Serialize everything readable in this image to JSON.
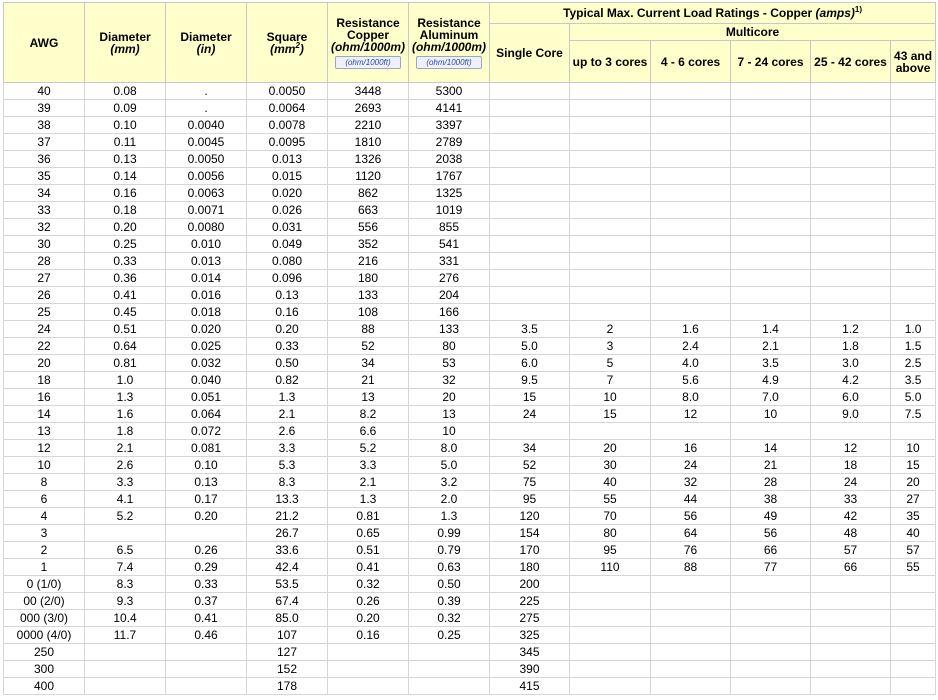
{
  "headers": {
    "awg": "AWG",
    "diam_mm": "Diameter",
    "diam_mm_unit": "(mm)",
    "diam_in": "Diameter",
    "diam_in_unit": "(in)",
    "square": "Square",
    "square_unit_pre": "(mm",
    "square_unit_sup": "2",
    "square_unit_post": ")",
    "res_cu": "Resistance Copper",
    "res_cu_unit": "(ohm/1000m)",
    "res_cu_btn": "(ohm/1000ft)",
    "res_al": "Resistance Aluminum",
    "res_al_unit": "(ohm/1000m)",
    "res_al_btn": "(ohm/1000ft)",
    "load_title": "Typical Max. Current Load Ratings - Copper ",
    "load_title_unit": "(amps)",
    "load_title_sup": "1)",
    "single_core": "Single Core",
    "multicore": "Multicore",
    "c1": "up to 3 cores",
    "c2": "4 - 6 cores",
    "c3": "7 - 24 cores",
    "c4": "25 - 42 cores",
    "c5": "43 and above"
  },
  "rows": [
    [
      "40",
      "0.08",
      ".",
      "0.0050",
      "3448",
      "5300",
      "",
      "",
      "",
      "",
      "",
      ""
    ],
    [
      "39",
      "0.09",
      ".",
      "0.0064",
      "2693",
      "4141",
      "",
      "",
      "",
      "",
      "",
      ""
    ],
    [
      "38",
      "0.10",
      "0.0040",
      "0.0078",
      "2210",
      "3397",
      "",
      "",
      "",
      "",
      "",
      ""
    ],
    [
      "37",
      "0.11",
      "0.0045",
      "0.0095",
      "1810",
      "2789",
      "",
      "",
      "",
      "",
      "",
      ""
    ],
    [
      "36",
      "0.13",
      "0.0050",
      "0.013",
      "1326",
      "2038",
      "",
      "",
      "",
      "",
      "",
      ""
    ],
    [
      "35",
      "0.14",
      "0.0056",
      "0.015",
      "1120",
      "1767",
      "",
      "",
      "",
      "",
      "",
      ""
    ],
    [
      "34",
      "0.16",
      "0.0063",
      "0.020",
      "862",
      "1325",
      "",
      "",
      "",
      "",
      "",
      ""
    ],
    [
      "33",
      "0.18",
      "0.0071",
      "0.026",
      "663",
      "1019",
      "",
      "",
      "",
      "",
      "",
      ""
    ],
    [
      "32",
      "0.20",
      "0.0080",
      "0.031",
      "556",
      "855",
      "",
      "",
      "",
      "",
      "",
      ""
    ],
    [
      "30",
      "0.25",
      "0.010",
      "0.049",
      "352",
      "541",
      "",
      "",
      "",
      "",
      "",
      ""
    ],
    [
      "28",
      "0.33",
      "0.013",
      "0.080",
      "216",
      "331",
      "",
      "",
      "",
      "",
      "",
      ""
    ],
    [
      "27",
      "0.36",
      "0.014",
      "0.096",
      "180",
      "276",
      "",
      "",
      "",
      "",
      "",
      ""
    ],
    [
      "26",
      "0.41",
      "0.016",
      "0.13",
      "133",
      "204",
      "",
      "",
      "",
      "",
      "",
      ""
    ],
    [
      "25",
      "0.45",
      "0.018",
      "0.16",
      "108",
      "166",
      "",
      "",
      "",
      "",
      "",
      ""
    ],
    [
      "24",
      "0.51",
      "0.020",
      "0.20",
      "88",
      "133",
      "3.5",
      "2",
      "1.6",
      "1.4",
      "1.2",
      "1.0"
    ],
    [
      "22",
      "0.64",
      "0.025",
      "0.33",
      "52",
      "80",
      "5.0",
      "3",
      "2.4",
      "2.1",
      "1.8",
      "1.5"
    ],
    [
      "20",
      "0.81",
      "0.032",
      "0.50",
      "34",
      "53",
      "6.0",
      "5",
      "4.0",
      "3.5",
      "3.0",
      "2.5"
    ],
    [
      "18",
      "1.0",
      "0.040",
      "0.82",
      "21",
      "32",
      "9.5",
      "7",
      "5.6",
      "4.9",
      "4.2",
      "3.5"
    ],
    [
      "16",
      "1.3",
      "0.051",
      "1.3",
      "13",
      "20",
      "15",
      "10",
      "8.0",
      "7.0",
      "6.0",
      "5.0"
    ],
    [
      "14",
      "1.6",
      "0.064",
      "2.1",
      "8.2",
      "13",
      "24",
      "15",
      "12",
      "10",
      "9.0",
      "7.5"
    ],
    [
      "13",
      "1.8",
      "0.072",
      "2.6",
      "6.6",
      "10",
      "",
      "",
      "",
      "",
      "",
      ""
    ],
    [
      "12",
      "2.1",
      "0.081",
      "3.3",
      "5.2",
      "8.0",
      "34",
      "20",
      "16",
      "14",
      "12",
      "10"
    ],
    [
      "10",
      "2.6",
      "0.10",
      "5.3",
      "3.3",
      "5.0",
      "52",
      "30",
      "24",
      "21",
      "18",
      "15"
    ],
    [
      "8",
      "3.3",
      "0.13",
      "8.3",
      "2.1",
      "3.2",
      "75",
      "40",
      "32",
      "28",
      "24",
      "20"
    ],
    [
      "6",
      "4.1",
      "0.17",
      "13.3",
      "1.3",
      "2.0",
      "95",
      "55",
      "44",
      "38",
      "33",
      "27"
    ],
    [
      "4",
      "5.2",
      "0.20",
      "21.2",
      "0.81",
      "1.3",
      "120",
      "70",
      "56",
      "49",
      "42",
      "35"
    ],
    [
      "3",
      "",
      "",
      "26.7",
      "0.65",
      "0.99",
      "154",
      "80",
      "64",
      "56",
      "48",
      "40"
    ],
    [
      "2",
      "6.5",
      "0.26",
      "33.6",
      "0.51",
      "0.79",
      "170",
      "95",
      "76",
      "66",
      "57",
      "57"
    ],
    [
      "1",
      "7.4",
      "0.29",
      "42.4",
      "0.41",
      "0.63",
      "180",
      "110",
      "88",
      "77",
      "66",
      "55"
    ],
    [
      "0 (1/0)",
      "8.3",
      "0.33",
      "53.5",
      "0.32",
      "0.50",
      "200",
      "",
      "",
      "",
      "",
      ""
    ],
    [
      "00 (2/0)",
      "9.3",
      "0.37",
      "67.4",
      "0.26",
      "0.39",
      "225",
      "",
      "",
      "",
      "",
      ""
    ],
    [
      "000 (3/0)",
      "10.4",
      "0.41",
      "85.0",
      "0.20",
      "0.32",
      "275",
      "",
      "",
      "",
      "",
      ""
    ],
    [
      "0000 (4/0)",
      "11.7",
      "0.46",
      "107",
      "0.16",
      "0.25",
      "325",
      "",
      "",
      "",
      "",
      ""
    ],
    [
      "250",
      "",
      "",
      "127",
      "",
      "",
      "345",
      "",
      "",
      "",
      "",
      ""
    ],
    [
      "300",
      "",
      "",
      "152",
      "",
      "",
      "390",
      "",
      "",
      "",
      "",
      ""
    ],
    [
      "400",
      "",
      "",
      "178",
      "",
      "",
      "415",
      "",
      "",
      "",
      "",
      ""
    ]
  ]
}
